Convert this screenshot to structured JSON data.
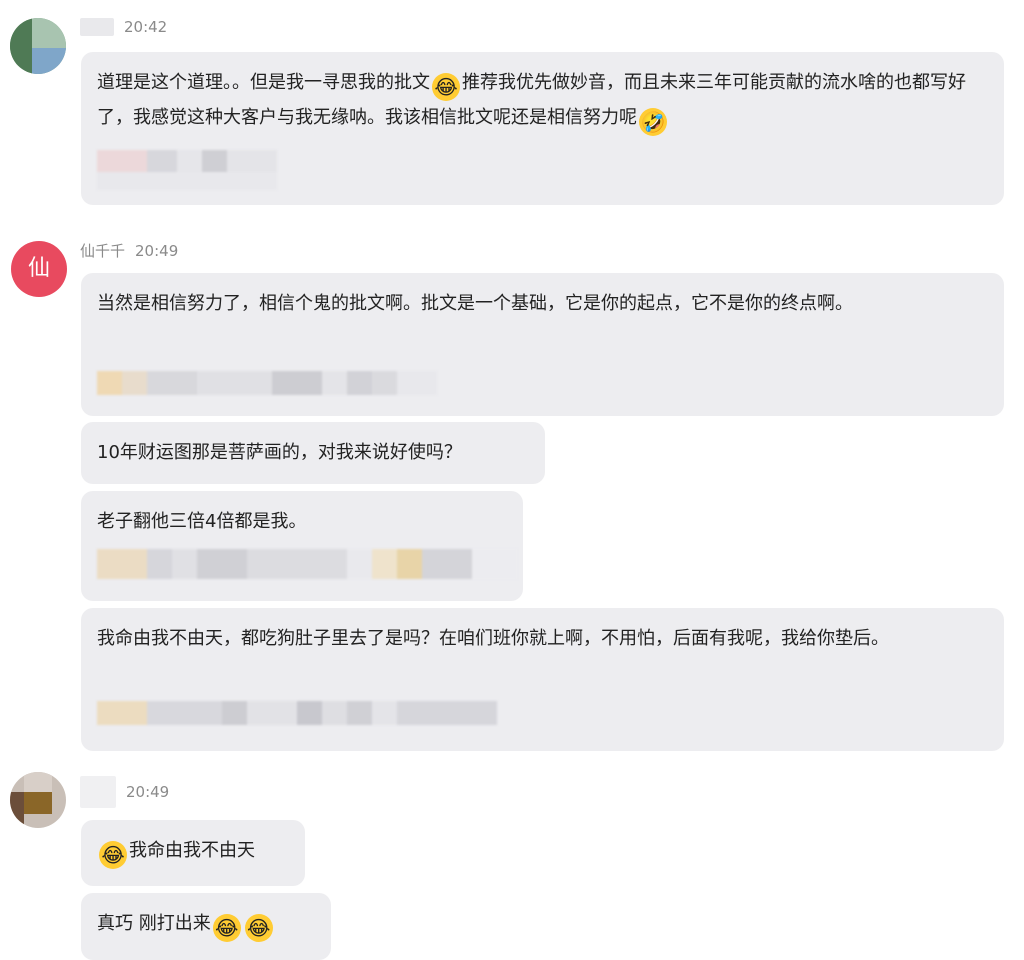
{
  "messages": [
    {
      "time": "20:42",
      "text_a": "道理是这个道理。。但是我一寻思我的批文",
      "emoji_a": "😂",
      "text_b": "推荐我优先做妙音，而且未来三年可能贡献的流水啥的也都写好了，我感觉这种大客户与我无缘呐。我该相信批文呢还是相信努力呢",
      "emoji_b": "🤣"
    },
    {
      "name": "仙千千",
      "time": "20:49",
      "avatar_text": "仙",
      "bubbles": [
        "当然是相信努力了，相信个鬼的批文啊。批文是一个基础，它是你的起点，它不是你的终点啊。",
        "10年财运图那是菩萨画的，对我来说好使吗？",
        "老子翻他三倍4倍都是我。",
        "我命由我不由天，都吃狗肚子里去了是吗？在咱们班你就上啊，不用怕，后面有我呢，我给你垫后。"
      ]
    },
    {
      "time": "20:49",
      "emoji_c": "😂",
      "text_c": "我命由我不由天",
      "text_d": "真巧 刚打出来",
      "emoji_d1": "😂",
      "emoji_d2": "😂"
    }
  ],
  "colors": {
    "bubble": "#ededf0",
    "meta_text": "#8a8a8a",
    "avatar_red": "#e84a5f"
  }
}
